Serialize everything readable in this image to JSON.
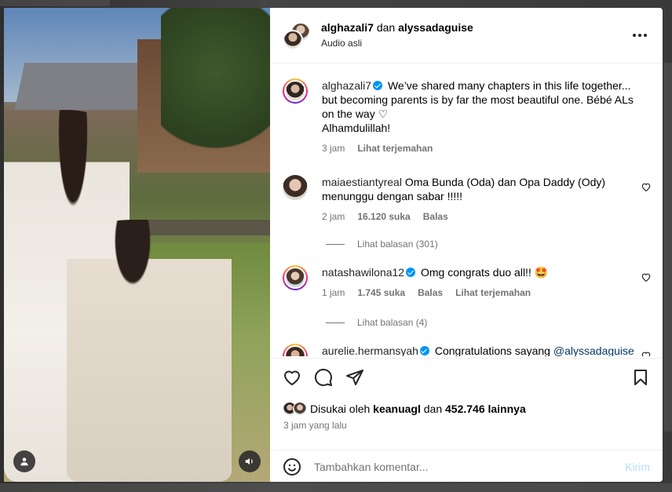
{
  "header": {
    "user1": "alghazali7",
    "connector": "dan",
    "user2": "alyssadaguise",
    "subtitle": "Audio asli",
    "more_icon": "more-horizontal-icon"
  },
  "caption": {
    "user": "alghazali7",
    "text": "We’ve shared many chapters in this life together... but becoming parents is by far the most beautiful one. Bébé ALs on the way ♡",
    "text2": "Alhamdulillah!",
    "time": "3 jam",
    "translate": "Lihat terjemahan"
  },
  "comments": [
    {
      "user": "maiaestiantyreal",
      "text": "Oma Bunda (Oda) dan Opa Daddy (Ody) menunggu dengan sabar !!!!!",
      "time": "2 jam",
      "likes": "16.120 suka",
      "reply": "Balas",
      "replies_label": "Lihat balasan (301)"
    },
    {
      "user": "natashawilona12",
      "text": "Omg congrats duo all!! 🤩",
      "time": "1 jam",
      "likes": "1.745 suka",
      "reply": "Balas",
      "translate": "Lihat terjemahan",
      "replies_label": "Lihat balasan (4)"
    },
    {
      "user": "aurelie.hermansyah",
      "text": "Congratulations sayang ",
      "mention": "@alyssadaguise"
    }
  ],
  "actions": {
    "liked_prefix": "Disukai oleh",
    "liked_user": "keanuagl",
    "liked_and": "dan",
    "liked_count": "452.746 lainnya",
    "time": "3 jam yang lalu"
  },
  "composer": {
    "placeholder": "Tambahkan komentar...",
    "send": "Kirim"
  },
  "colors": {
    "accent": "#0095f6",
    "muted": "#737373",
    "send_disabled": "#b2dffc"
  }
}
